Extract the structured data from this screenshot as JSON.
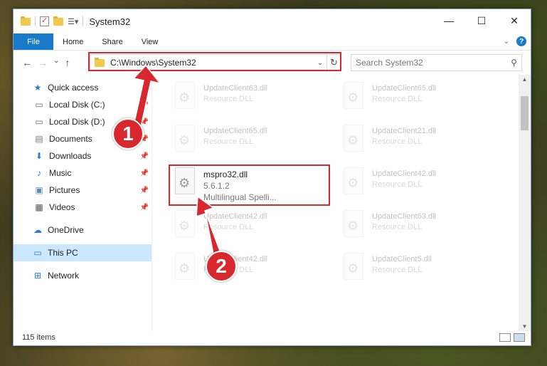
{
  "window": {
    "title": "System32",
    "controls": {
      "minimize": "—",
      "maximize": "☐",
      "close": "✕"
    }
  },
  "ribbon": {
    "tabs": [
      "File",
      "Home",
      "Share",
      "View"
    ]
  },
  "address": {
    "path": "C:\\Windows\\System32",
    "search_placeholder": "Search System32"
  },
  "sidebar": {
    "items": [
      {
        "label": "Quick access",
        "icon": "star-icon",
        "pinned": false
      },
      {
        "label": "Local Disk (C:)",
        "icon": "drive-icon",
        "pinned": true
      },
      {
        "label": "Local Disk (D:)",
        "icon": "drive-icon",
        "pinned": true
      },
      {
        "label": "Documents",
        "icon": "documents-icon",
        "pinned": true
      },
      {
        "label": "Downloads",
        "icon": "download-icon",
        "pinned": true
      },
      {
        "label": "Music",
        "icon": "music-icon",
        "pinned": true
      },
      {
        "label": "Pictures",
        "icon": "pictures-icon",
        "pinned": true
      },
      {
        "label": "Videos",
        "icon": "videos-icon",
        "pinned": true
      },
      {
        "label": "OneDrive",
        "icon": "cloud-icon",
        "pinned": false
      },
      {
        "label": "This PC",
        "icon": "computer-icon",
        "pinned": false,
        "selected": true
      },
      {
        "label": "Network",
        "icon": "network-icon",
        "pinned": false
      }
    ]
  },
  "files": [
    {
      "name": "UpdateClient63.dll",
      "type": "Resource DLL"
    },
    {
      "name": "UpdateClient65.dll",
      "type": "Resource DLL"
    },
    {
      "name": "UpdateClient65.dll",
      "type": "Resource DLL"
    },
    {
      "name": "UpdateClient21.dll",
      "type": "Resource DLL"
    },
    {
      "name": "mspro32.dll",
      "version": "5.6.1.2",
      "type": "Multilingual Spelli..."
    },
    {
      "name": "UpdateClient42.dll",
      "type": "Resource DLL"
    },
    {
      "name": "UpdateClient42.dll",
      "type": "Resource DLL"
    },
    {
      "name": "UpdateClient63.dll",
      "type": "Resource DLL"
    },
    {
      "name": "UpdateClient42.dll",
      "type": "Resource DLL"
    },
    {
      "name": "UpdateClient5.dll",
      "type": "Resource DLL"
    }
  ],
  "status": {
    "item_count": "115 items"
  },
  "annotations": {
    "step1": "1",
    "step2": "2",
    "highlight_color": "#d9272e"
  }
}
